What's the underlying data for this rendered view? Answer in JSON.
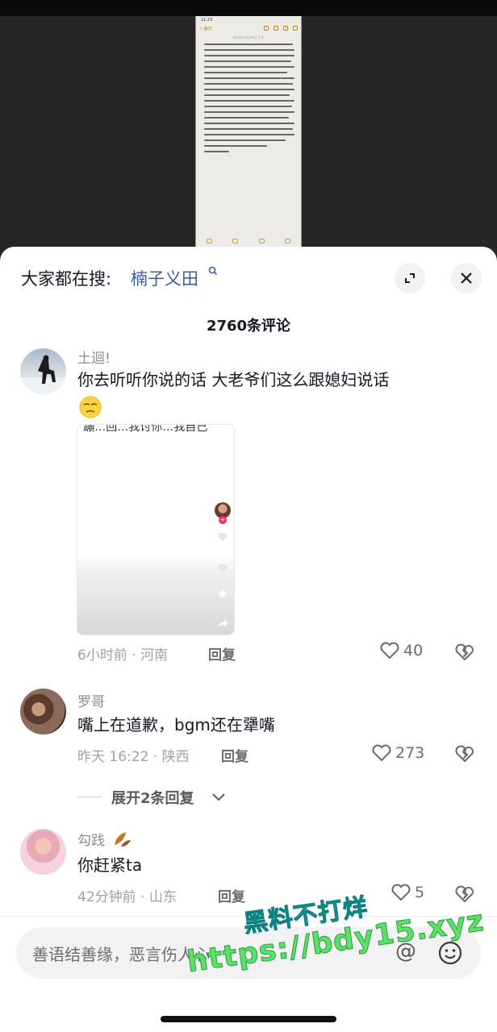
{
  "video": {
    "phone_back": "< 备忘",
    "phone_date": "2024年4月26日 下午"
  },
  "header": {
    "search_prefix": "大家都在搜:",
    "search_term": "楠子义田",
    "expand_icon": "expand-icon",
    "close_icon": "close-icon"
  },
  "comment_count": "2760条评论",
  "comments": [
    {
      "username": "土迴!",
      "text_line1": "你去听听你说的话 大老爷们这么跟媳妇说话",
      "emoji": "awkward-smile-emoji",
      "thumb_caption": "“蹦…回…我讨你…我自己",
      "meta": "6小时前 · 河南",
      "reply": "回复",
      "likes": "40"
    },
    {
      "username": "罗哥",
      "text_line1": "嘴上在道歉，bgm还在犟嘴",
      "meta": "昨天 16:22 · 陕西",
      "reply": "回复",
      "likes": "273"
    },
    {
      "username": "勾践",
      "text_line1": "你赶紧ta",
      "meta": "42分钟前 · 山东",
      "reply": "回复",
      "likes": "5"
    }
  ],
  "expand_replies": "展开2条回复",
  "input": {
    "placeholder": "善语结善缘，恶言伤人心"
  },
  "watermark": {
    "line1": "黑料不打烊",
    "line2": "https://bdy15.xyz"
  },
  "colors": {
    "accent_link": "#3b5fa5",
    "text_primary": "#161823",
    "text_secondary": "#8a8b91",
    "sheet_bg": "#ffffff",
    "dim_bg": "#262626"
  }
}
